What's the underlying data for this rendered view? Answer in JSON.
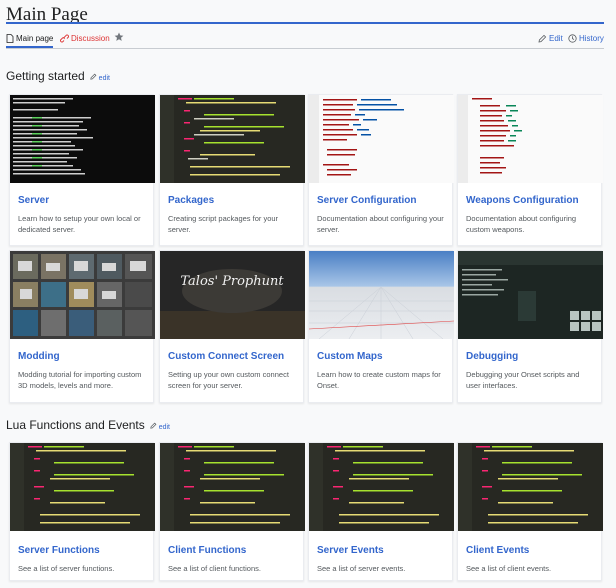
{
  "page": {
    "title": "Main Page"
  },
  "tabs": {
    "main_page": "Main page",
    "discussion": "Discussion",
    "edit": "Edit",
    "history": "History"
  },
  "sections": {
    "getting_started": {
      "title": "Getting started",
      "edit": "edit"
    },
    "lua": {
      "title": "Lua Functions and Events",
      "edit": "edit"
    }
  },
  "cards": {
    "server": {
      "title": "Server",
      "desc": "Learn how to setup your own local or dedicated server."
    },
    "packages": {
      "title": "Packages",
      "desc": "Creating script packages for your server."
    },
    "server_config": {
      "title": "Server Configuration",
      "desc": "Documentation about configuring your server."
    },
    "weapons_config": {
      "title": "Weapons Configuration",
      "desc": "Documentation about configuring custom weapons."
    },
    "modding": {
      "title": "Modding",
      "desc": "Modding tutorial for importing custom 3D models, levels and more."
    },
    "custom_connect": {
      "title": "Custom Connect Screen",
      "desc": "Setting up your own custom connect screen for your server.",
      "promo_text": "Talos' Prophunt"
    },
    "custom_maps": {
      "title": "Custom Maps",
      "desc": "Learn how to create custom maps for Onset."
    },
    "debugging": {
      "title": "Debugging",
      "desc": "Debugging your Onset scripts and user interfaces."
    },
    "server_functions": {
      "title": "Server Functions",
      "desc": "See a list of server functions."
    },
    "client_functions": {
      "title": "Client Functions",
      "desc": "See a list of client functions."
    },
    "server_events": {
      "title": "Server Events",
      "desc": "See a list of server events."
    },
    "client_events": {
      "title": "Client Events",
      "desc": "See a list of client events."
    }
  },
  "colors": {
    "link": "#3366cc",
    "discussion": "#dd3333",
    "text": "#202122",
    "muted": "#54595d"
  }
}
